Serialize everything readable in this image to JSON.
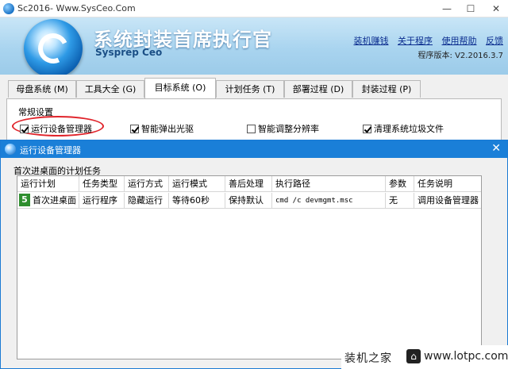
{
  "window": {
    "title": "Sc2016- Www.SysCeo.Com",
    "minimize_glyph": "—",
    "maximize_glyph": "☐",
    "close_glyph": "✕"
  },
  "banner": {
    "app_name": "系统封装首席执行官",
    "app_subtitle": "Sysprep Ceo",
    "links": [
      "装机赚钱",
      "关于程序",
      "使用帮助",
      "反馈"
    ],
    "version": "程序版本: V2.2016.3.7"
  },
  "tabs": [
    {
      "label": "母盘系统 (M)",
      "active": false
    },
    {
      "label": "工具大全 (G)",
      "active": false
    },
    {
      "label": "目标系统 (O)",
      "active": true
    },
    {
      "label": "计划任务 (T)",
      "active": false
    },
    {
      "label": "部署过程 (D)",
      "active": false
    },
    {
      "label": "封装过程 (P)",
      "active": false
    }
  ],
  "general_settings": {
    "label": "常规设置",
    "options": [
      {
        "label": "运行设备管理器",
        "checked": true
      },
      {
        "label": "智能弹出光驱",
        "checked": true
      },
      {
        "label": "智能调整分辨率",
        "checked": false
      },
      {
        "label": "清理系统垃圾文件",
        "checked": true
      }
    ]
  },
  "dialog": {
    "title": "运行设备管理器",
    "close_glyph": "✕",
    "section_title": "首次进桌面的计划任务",
    "columns": [
      "运行计划",
      "任务类型",
      "运行方式",
      "运行模式",
      "善后处理",
      "执行路径",
      "参数",
      "任务说明"
    ],
    "rows": [
      {
        "badge": "5",
        "plan": "首次进桌面",
        "type": "运行程序",
        "mode": "隐藏运行",
        "run_mode": "等待60秒",
        "after": "保持默认",
        "path": "cmd /c devmgmt.msc",
        "args": "无",
        "desc": "调用设备管理器"
      }
    ]
  },
  "watermark": {
    "text": "装机之家",
    "url": "www.lotpc.com"
  },
  "colors": {
    "dialog_title_bg": "#1a7fd8",
    "highlight_ellipse": "#e0242b",
    "badge_green": "#2f8f2f"
  }
}
